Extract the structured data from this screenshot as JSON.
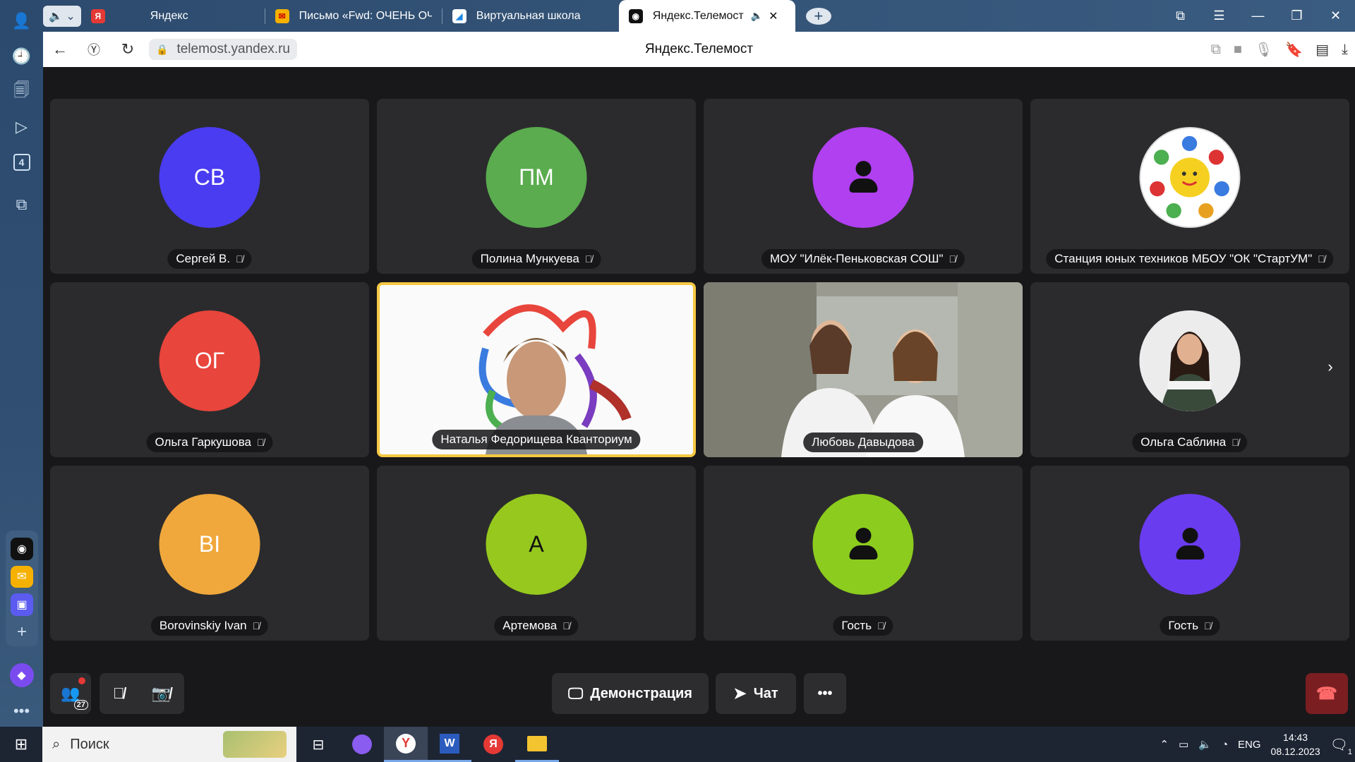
{
  "browser": {
    "tabs": [
      {
        "label": "Яндекс",
        "favicon": "yandex-icon",
        "color": "#e53935"
      },
      {
        "label": "Письмо «Fwd: ОЧЕНЬ ОЧЕ",
        "favicon": "mail-icon",
        "color": "#f6b100"
      },
      {
        "label": "Виртуальная школа",
        "favicon": "school-icon",
        "color": "#1e88e5"
      },
      {
        "label": "Яндекс.Телемост",
        "favicon": "telemost-icon",
        "color": "#111111"
      }
    ],
    "url": "telemost.yandex.ru",
    "page_title": "Яндекс.Телемост",
    "side_badge": "4"
  },
  "participants": [
    {
      "initials": "СВ",
      "name": "Сергей В.",
      "color": "#4a3cf0",
      "type": "initials"
    },
    {
      "initials": "ПМ",
      "name": "Полина Мункуева",
      "color": "#5aac4e",
      "type": "initials"
    },
    {
      "initials": "",
      "name": "МОУ \"Илёк-Пеньковская СОШ\"",
      "color": "#b040f0",
      "type": "person"
    },
    {
      "initials": "",
      "name": "Станция юных техников МБОУ \"ОК \"СтартУМ\"",
      "color": "#ffffff",
      "type": "logo"
    },
    {
      "initials": "ОГ",
      "name": "Ольга Гаркушова",
      "color": "#e8453c",
      "type": "initials"
    },
    {
      "initials": "",
      "name": "Наталья Федорищева Кванториум",
      "color": "#ffffff",
      "type": "video"
    },
    {
      "initials": "",
      "name": "Любовь Давыдова",
      "color": "#8a8a80",
      "type": "video"
    },
    {
      "initials": "",
      "name": "Ольга Саблина",
      "color": "#e5e5e5",
      "type": "photo"
    },
    {
      "initials": "BI",
      "name": "Borovinskiy Ivan",
      "color": "#f0a83c",
      "type": "initials"
    },
    {
      "initials": "А",
      "name": "Артемова",
      "color": "#96c81e",
      "type": "initials"
    },
    {
      "initials": "",
      "name": "Гость",
      "color": "#8ccc1e",
      "type": "person"
    },
    {
      "initials": "",
      "name": "Гость",
      "color": "#6a3cf0",
      "type": "person"
    }
  ],
  "controls": {
    "participants_count": "27",
    "demo_label": "Демонстрация",
    "chat_label": "Чат"
  },
  "taskbar": {
    "search_label": "Поиск",
    "language": "ENG",
    "time": "14:43",
    "date": "08.12.2023",
    "notifications": "1"
  }
}
